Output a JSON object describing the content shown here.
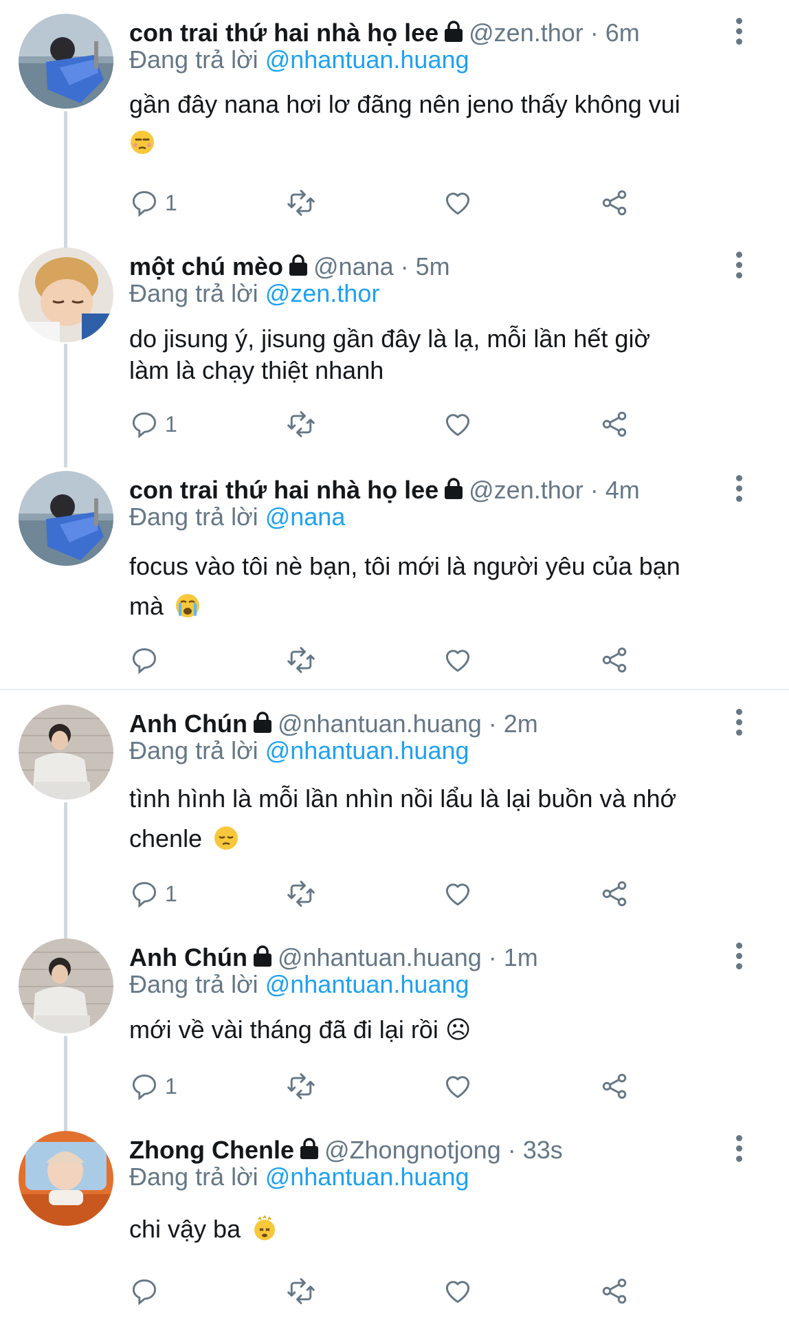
{
  "tweets": [
    {
      "name": "con trai thứ hai nhà họ lee",
      "handle": "@zen.thor",
      "time": "· 6m",
      "replying_label": "Đang trả lời",
      "replying_to": "@nhantuan.huang",
      "lines": [
        "gần đây nana hơi lơ đãng nên jeno thấy không vui"
      ],
      "emoji": "unamused-face",
      "reply_count": "1",
      "avatar": "blue-jacket-avatar"
    },
    {
      "name": "một chú mèo",
      "handle": "@nana",
      "time": "· 5m",
      "replying_label": "Đang trả lời",
      "replying_to": "@zen.thor",
      "lines": [
        "do jisung ý, jisung gần đây là lạ, mỗi lần hết giờ",
        "làm là chạy thiệt nhanh"
      ],
      "reply_count": "1",
      "avatar": "blond-avatar"
    },
    {
      "name": "con trai thứ hai nhà họ lee",
      "handle": "@zen.thor",
      "time": "· 4m",
      "replying_label": "Đang trả lời",
      "replying_to": "@nana",
      "lines": [
        "focus vào tôi nè bạn, tôi mới là người yêu của bạn",
        "mà"
      ],
      "emoji": "crying-face",
      "reply_count": "",
      "avatar": "blue-jacket-avatar"
    },
    {
      "name": "Anh Chún",
      "handle": "@nhantuan.huang",
      "time": "· 2m",
      "replying_label": "Đang trả lời",
      "replying_to": "@nhantuan.huang",
      "lines": [
        "tình hình là mỗi lần nhìn nồi lẩu là lại buồn và nhớ",
        "chenle"
      ],
      "emoji": "pensive-face",
      "reply_count": "1",
      "avatar": "sweater-avatar"
    },
    {
      "name": "Anh Chún",
      "handle": "@nhantuan.huang",
      "time": "· 1m",
      "replying_label": "Đang trả lời",
      "replying_to": "@nhantuan.huang",
      "lines": [
        "mới về vài tháng đã đi lại rồi ☹"
      ],
      "reply_count": "1",
      "avatar": "sweater-avatar"
    },
    {
      "name": "Zhong Chenle",
      "handle": "@Zhongnotjong",
      "time": "· 33s",
      "replying_label": "Đang trả lời",
      "replying_to": "@nhantuan.huang",
      "lines": [
        "chi vậy ba"
      ],
      "emoji": "dizzy-face",
      "reply_count": "",
      "avatar": "orange-car-avatar"
    }
  ],
  "colors": {
    "text": "#14171a",
    "muted": "#657786",
    "link": "#1da1f2",
    "thread": "#cfd9de",
    "divider": "#e6ecf0"
  }
}
